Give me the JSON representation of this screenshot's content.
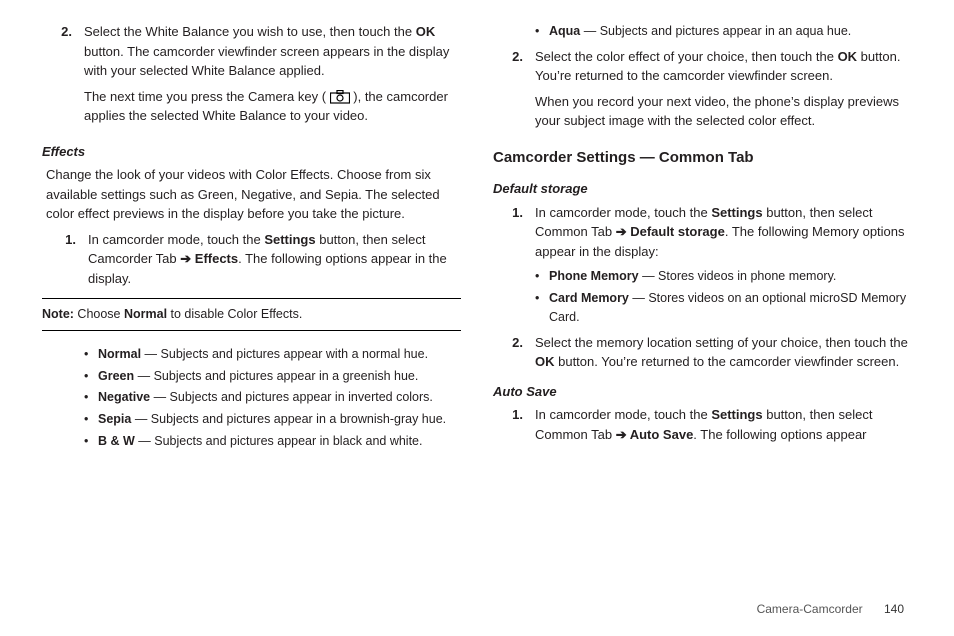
{
  "left": {
    "step2_num": "2.",
    "step2_p1a": "Select the White Balance you wish to use, then touch the ",
    "step2_ok": "OK",
    "step2_p1b": " button. The camcorder viewfinder screen appears in the display with your selected White Balance applied.",
    "step2_p2a": "The next time you press the Camera key ( ",
    "step2_p2b": " ), the camcorder applies the selected White Balance to your video.",
    "effects_heading": "Effects",
    "effects_para": "Change the look of your videos with Color Effects. Choose from six available settings such as Green, Negative, and Sepia. The selected color effect previews in the display before you take the picture.",
    "effects_step1_num": "1.",
    "effects_step1_a": "In camcorder mode, touch the ",
    "effects_step1_settings": "Settings",
    "effects_step1_b": " button, then select Camcorder Tab ",
    "arrow": "➔",
    "effects_step1_effects": " Effects",
    "effects_step1_c": ". The following options appear in the display.",
    "note_label": "Note:",
    "note_a": " Choose ",
    "note_normal": "Normal",
    "note_b": " to disable Color Effects.",
    "bullets": [
      {
        "name": "Normal",
        "desc": " — Subjects and pictures appear with a normal hue."
      },
      {
        "name": "Green",
        "desc": " — Subjects and pictures appear in a greenish hue."
      },
      {
        "name": "Negative",
        "desc": " — Subjects and pictures appear in inverted colors."
      },
      {
        "name": "Sepia",
        "desc": " — Subjects and pictures appear in a brownish-gray hue."
      },
      {
        "name": "B & W",
        "desc": " — Subjects and pictures appear in black and white."
      }
    ]
  },
  "right": {
    "aqua_name": "Aqua",
    "aqua_desc": " — Subjects and pictures appear in an aqua hue.",
    "step2_num": "2.",
    "step2_a": "Select the color effect of your choice, then touch the ",
    "step2_ok": "OK",
    "step2_b": " button. You’re returned to the camcorder viewfinder screen.",
    "step2_p2": "When you record your next video, the phone’s display previews your subject image with the selected color effect.",
    "h2": "Camcorder Settings — Common Tab",
    "default_storage_heading": "Default storage",
    "ds_step1_num": "1.",
    "ds_step1_a": "In camcorder mode, touch the ",
    "ds_step1_settings": "Settings",
    "ds_step1_b": " button, then select Common Tab ",
    "ds_step1_ds": " Default storage",
    "ds_step1_c": ". The following Memory options appear in the display:",
    "ds_bullets": [
      {
        "name": "Phone Memory",
        "desc": " — Stores videos in phone memory."
      },
      {
        "name": "Card Memory",
        "desc": " — Stores videos on an optional microSD Memory Card."
      }
    ],
    "ds_step2_num": "2.",
    "ds_step2_a": "Select the memory location setting of your choice, then touch the ",
    "ds_step2_ok": "OK",
    "ds_step2_b": " button. You’re returned to the camcorder viewfinder screen.",
    "autosave_heading": "Auto Save",
    "as_step1_num": "1.",
    "as_step1_a": "In camcorder mode, touch the ",
    "as_step1_settings": "Settings",
    "as_step1_b": " button, then select Common Tab ",
    "as_step1_as": " Auto Save",
    "as_step1_c": ". The following options appear"
  },
  "footer": {
    "section": "Camera-Camcorder",
    "page": "140"
  }
}
